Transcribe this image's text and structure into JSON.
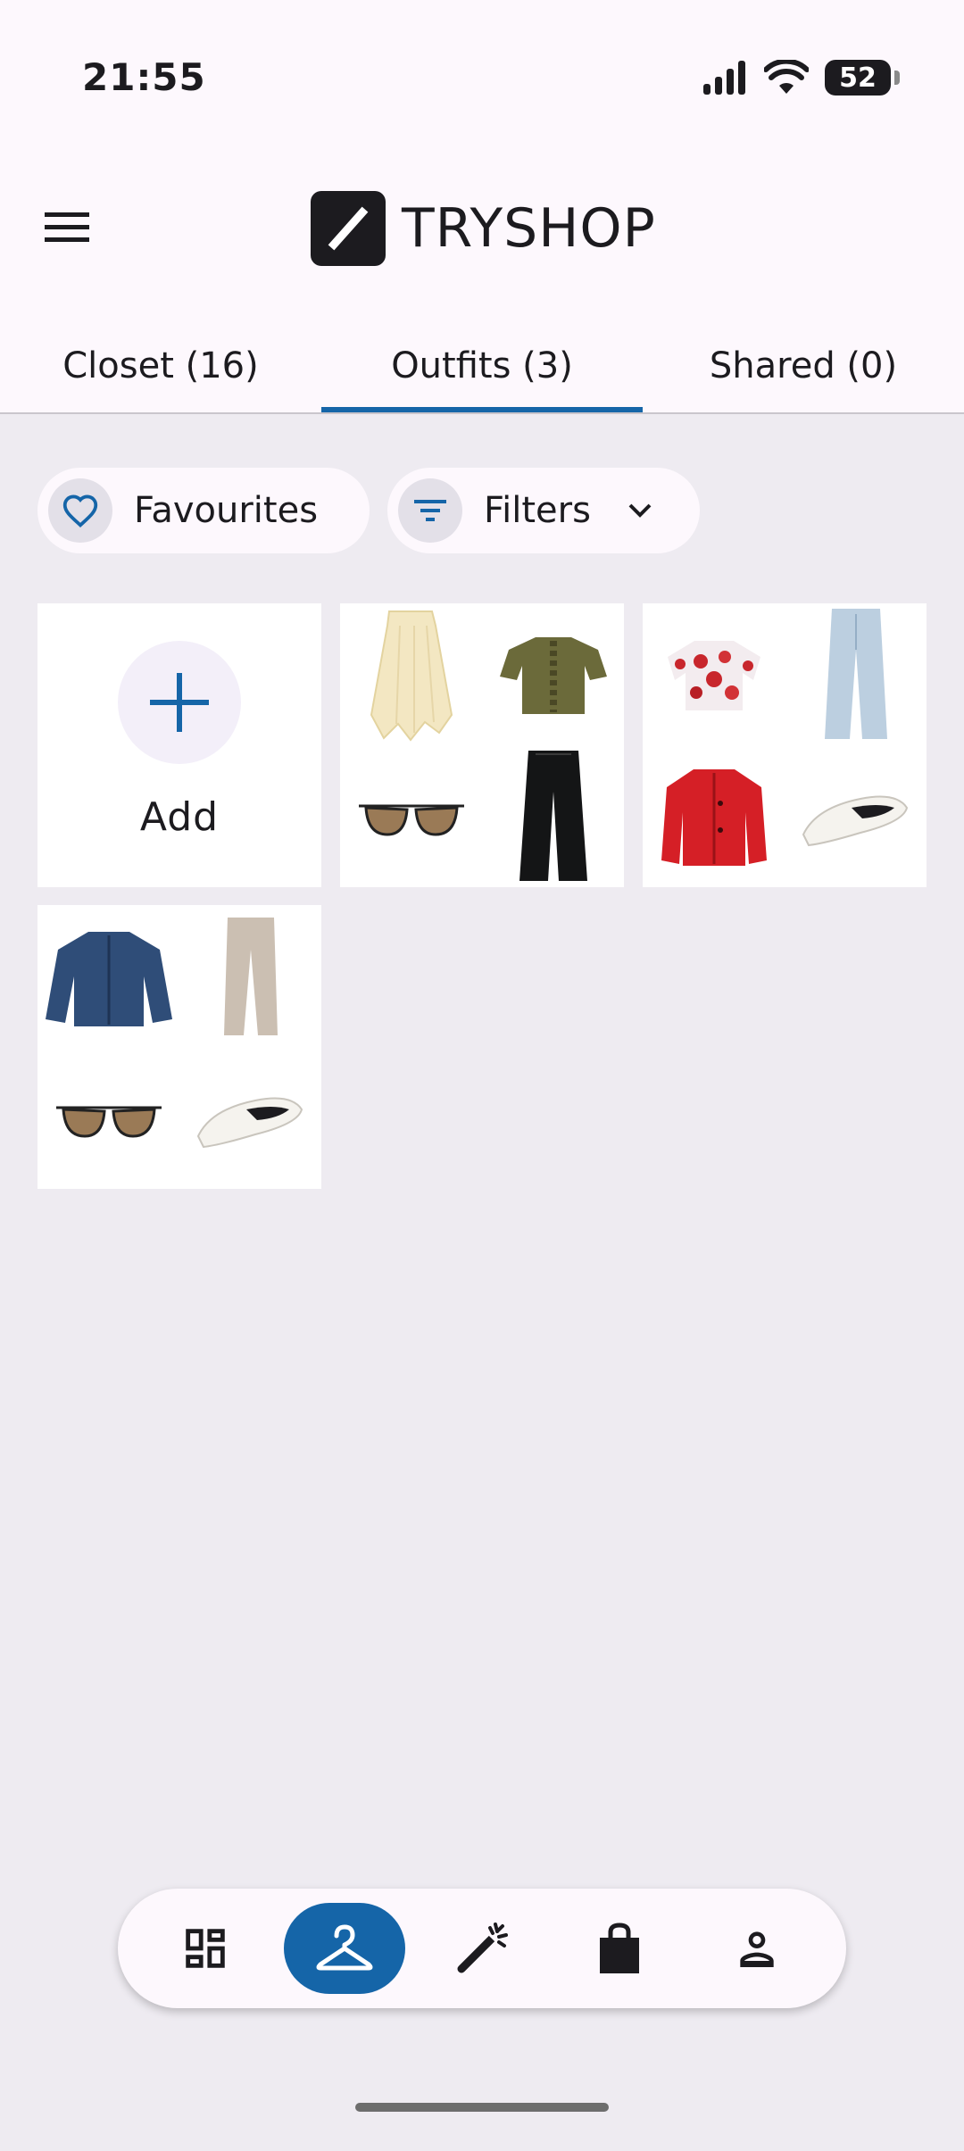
{
  "status_bar": {
    "time": "21:55",
    "battery": "52"
  },
  "app_bar": {
    "brand_name": "TRYSHOP",
    "menu_icon": "hamburger-menu-icon",
    "logo_icon": "tryshop-logo-icon"
  },
  "tabs": [
    {
      "label": "Closet (16)",
      "active": false
    },
    {
      "label": "Outfits (3)",
      "active": true
    },
    {
      "label": "Shared (0)",
      "active": false
    }
  ],
  "chips": {
    "favourites": {
      "label": "Favourites",
      "icon": "heart-outline-icon"
    },
    "filters": {
      "label": "Filters",
      "icon": "filter-icon",
      "trailing_icon": "chevron-down-icon"
    }
  },
  "add_tile": {
    "label": "Add",
    "icon": "plus-icon"
  },
  "outfits": [
    {
      "items": [
        "cream-skirt",
        "olive-ruffle-blouse",
        "brown-aviator-sunglasses",
        "black-wide-leg-jeans"
      ]
    },
    {
      "items": [
        "floral-puff-sleeve-blouse",
        "light-blue-jeans",
        "red-jacket",
        "white-ballet-flats"
      ]
    },
    {
      "items": [
        "blue-tweed-jacket",
        "beige-trousers",
        "brown-aviator-sunglasses",
        "white-ballet-flats"
      ]
    }
  ],
  "bottom_nav": [
    {
      "name": "dashboard",
      "icon": "dashboard-icon",
      "active": false
    },
    {
      "name": "closet",
      "icon": "hanger-icon",
      "active": true
    },
    {
      "name": "magic",
      "icon": "magic-wand-icon",
      "active": false
    },
    {
      "name": "shop",
      "icon": "shopping-bag-icon",
      "active": false
    },
    {
      "name": "profile",
      "icon": "person-icon",
      "active": false
    }
  ],
  "colors": {
    "accent": "#1565a8",
    "background": "#eeebf1",
    "surface": "#fdf8fd"
  }
}
